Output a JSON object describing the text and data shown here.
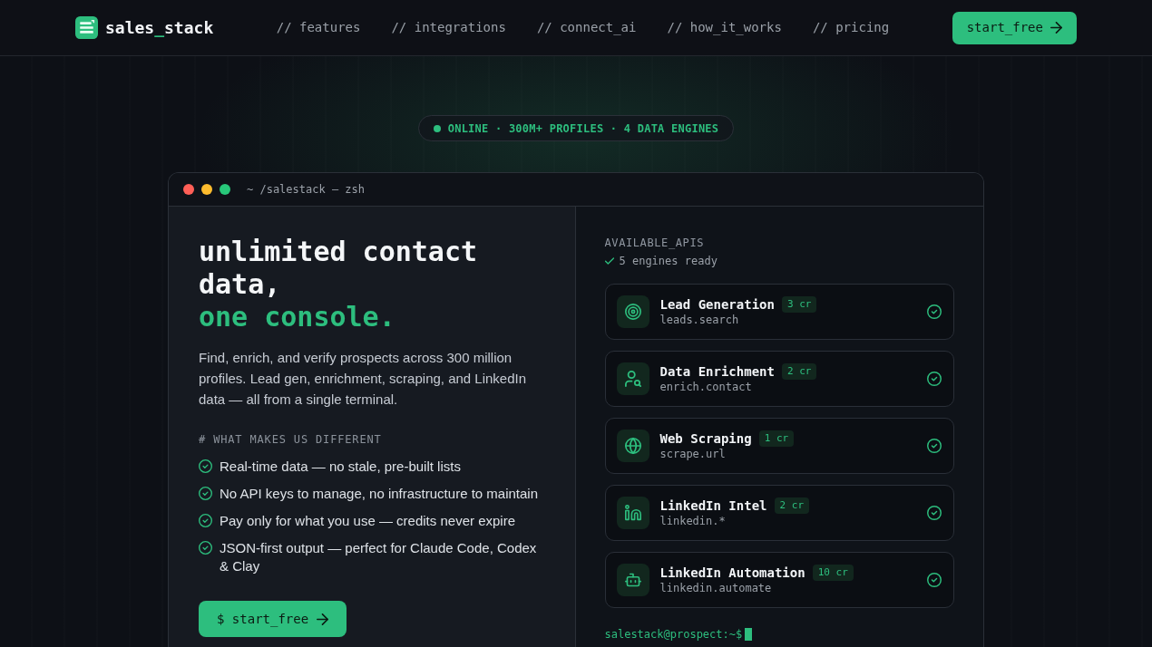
{
  "nav": {
    "brand": {
      "prefix": "sales",
      "accent": "_",
      "suffix": "stack"
    },
    "links": [
      "// features",
      "// integrations",
      "// connect_ai",
      "// how_it_works",
      "// pricing"
    ],
    "cta": "start_free"
  },
  "status_pill": "ONLINE · 300M+ PROFILES · 4 DATA ENGINES",
  "terminal": {
    "title": "~ /salestack — zsh",
    "hero": {
      "heading": "unlimited contact data,",
      "heading_accent": "one console.",
      "description": "Find, enrich, and verify prospects across 300 million profiles. Lead gen, enrichment, scraping, and LinkedIn data — all from a single terminal.",
      "section_label": "# WHAT MAKES US DIFFERENT",
      "features": [
        "Real-time data — no stale, pre-built lists",
        "No API keys to manage, no infrastructure to maintain",
        "Pay only for what you use — credits never expire",
        "JSON-first output — perfect for Claude Code, Codex & Clay"
      ],
      "cta": "$ start_free"
    },
    "apis_panel": {
      "title": "AVAILABLE_APIS",
      "status": "5 engines ready",
      "apis": [
        {
          "name": "Lead Generation",
          "credits": "3 cr",
          "endpoint": "leads.search"
        },
        {
          "name": "Data Enrichment",
          "credits": "2 cr",
          "endpoint": "enrich.contact"
        },
        {
          "name": "Web Scraping",
          "credits": "1 cr",
          "endpoint": "scrape.url"
        },
        {
          "name": "LinkedIn Intel",
          "credits": "2 cr",
          "endpoint": "linkedin.*"
        },
        {
          "name": "LinkedIn Automation",
          "credits": "10 cr",
          "endpoint": "linkedin.automate"
        }
      ],
      "prompt": "salestack@prospect:~$"
    }
  }
}
